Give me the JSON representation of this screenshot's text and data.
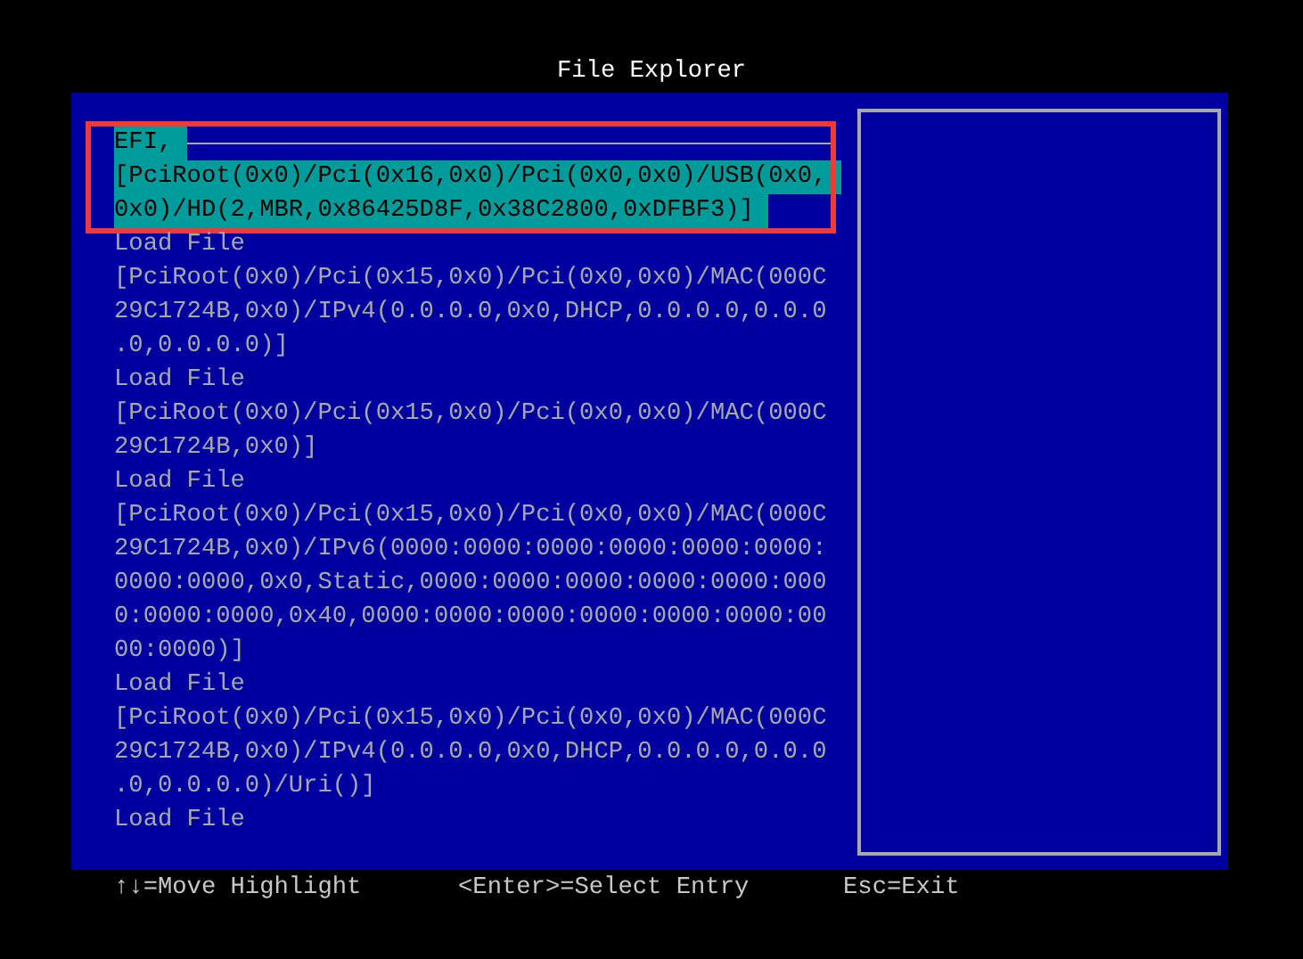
{
  "window": {
    "title": "File Explorer"
  },
  "entries": [
    {
      "selected": true,
      "lines": [
        "EFI,",
        "[PciRoot(0x0)/Pci(0x16,0x0)/Pci(0x0,0x0)/USB(0x0,",
        "0x0)/HD(2,MBR,0x86425D8F,0x38C2800,0xDFBF3)]"
      ]
    },
    {
      "selected": false,
      "lines": [
        "Load File",
        "[PciRoot(0x0)/Pci(0x15,0x0)/Pci(0x0,0x0)/MAC(000C",
        "29C1724B,0x0)/IPv4(0.0.0.0,0x0,DHCP,0.0.0.0,0.0.0",
        ".0,0.0.0.0)]"
      ]
    },
    {
      "selected": false,
      "lines": [
        "Load File",
        "[PciRoot(0x0)/Pci(0x15,0x0)/Pci(0x0,0x0)/MAC(000C",
        "29C1724B,0x0)]"
      ]
    },
    {
      "selected": false,
      "lines": [
        "Load File",
        "[PciRoot(0x0)/Pci(0x15,0x0)/Pci(0x0,0x0)/MAC(000C",
        "29C1724B,0x0)/IPv6(0000:0000:0000:0000:0000:0000:",
        "0000:0000,0x0,Static,0000:0000:0000:0000:0000:000",
        "0:0000:0000,0x40,0000:0000:0000:0000:0000:0000:00",
        "00:0000)]"
      ]
    },
    {
      "selected": false,
      "lines": [
        "Load File",
        "[PciRoot(0x0)/Pci(0x15,0x0)/Pci(0x0,0x0)/MAC(000C",
        "29C1724B,0x0)/IPv4(0.0.0.0,0x0,DHCP,0.0.0.0,0.0.0",
        ".0,0.0.0.0)/Uri()]"
      ]
    },
    {
      "selected": false,
      "lines": [
        "Load File"
      ]
    }
  ],
  "status_bar": [
    "↑↓=Move Highlight",
    "<Enter>=Select Entry",
    "Esc=Exit"
  ]
}
